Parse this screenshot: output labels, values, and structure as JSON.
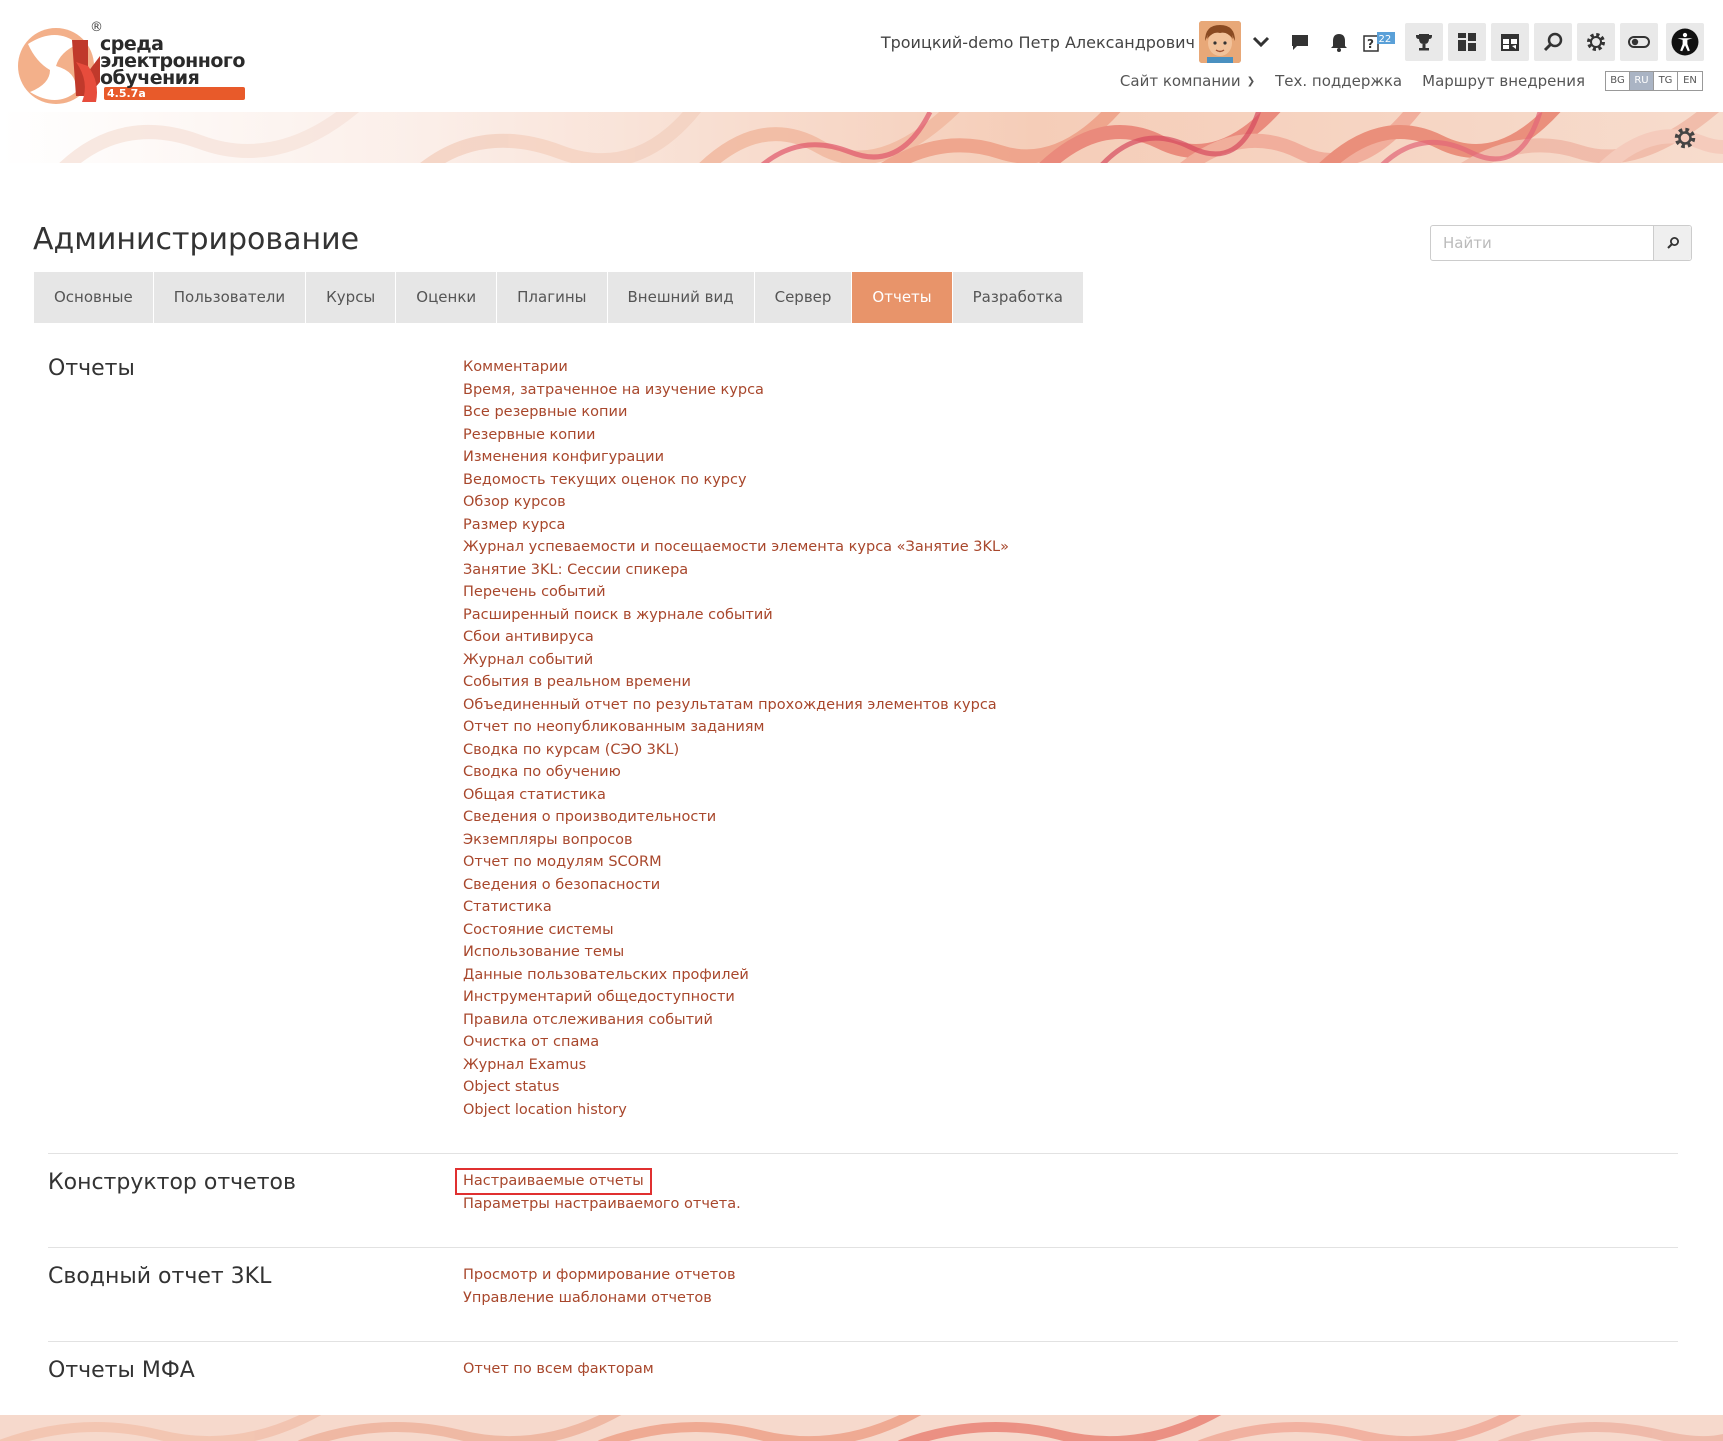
{
  "brand": {
    "line1": "среда",
    "line2": "электронного",
    "line3": "обучения",
    "version": "4.5.7a",
    "registered": "®"
  },
  "header": {
    "user_name": "Троицкий-demo Петр Александрович",
    "badge_count": "22",
    "icons": [
      "chevron-down-icon",
      "chat-icon",
      "bell-icon",
      "question-badge-icon",
      "trophy-icon",
      "dashboard-icon",
      "calendar-icon",
      "search-icon",
      "gear-icon",
      "toggle-icon",
      "accessibility-icon"
    ]
  },
  "topnav": {
    "company_site": "Сайт компании",
    "support": "Тех. поддержка",
    "route": "Маршрут внедрения",
    "languages": [
      "BG",
      "RU",
      "TG",
      "EN"
    ],
    "active_language": "RU"
  },
  "page": {
    "title": "Администрирование",
    "search_placeholder": "Найти"
  },
  "tabs": [
    {
      "label": "Основные",
      "active": false
    },
    {
      "label": "Пользователи",
      "active": false
    },
    {
      "label": "Курсы",
      "active": false
    },
    {
      "label": "Оценки",
      "active": false
    },
    {
      "label": "Плагины",
      "active": false
    },
    {
      "label": "Внешний вид",
      "active": false
    },
    {
      "label": "Сервер",
      "active": false
    },
    {
      "label": "Отчеты",
      "active": true
    },
    {
      "label": "Разработка",
      "active": false
    }
  ],
  "sections": [
    {
      "title": "Отчеты",
      "links": [
        "Комментарии",
        "Время, затраченное на изучение курса",
        "Все резервные копии",
        "Резервные копии",
        "Изменения конфигурации",
        "Ведомость текущих оценок по курсу",
        "Обзор курсов",
        "Размер курса",
        "Журнал успеваемости и посещаемости элемента курса «Занятие 3KL»",
        "Занятие 3KL: Сессии спикера",
        "Перечень событий",
        "Расширенный поиск в журнале событий",
        "Сбои антивируса",
        "Журнал событий",
        "События в реальном времени",
        "Объединенный отчет по результатам прохождения элементов курса",
        "Отчет по неопубликованным заданиям",
        "Сводка по курсам (СЭО 3KL)",
        "Сводка по обучению",
        "Общая статистика",
        "Сведения о производительности",
        "Экземпляры вопросов",
        "Отчет по модулям SCORM",
        "Сведения о безопасности",
        "Статистика",
        "Состояние системы",
        "Использование темы",
        "Данные пользовательских профилей",
        "Инструментарий общедоступности",
        "Правила отслеживания событий",
        "Очистка от спама",
        "Журнал Examus",
        "Object status",
        "Object location history"
      ]
    },
    {
      "title": "Конструктор отчетов",
      "links": [
        "Настраиваемые отчеты",
        "Параметры настраиваемого отчета."
      ]
    },
    {
      "title": "Сводный отчет 3KL",
      "links": [
        "Просмотр и формирование отчетов",
        "Управление шаблонами отчетов"
      ]
    },
    {
      "title": "Отчеты МФА",
      "links": [
        "Отчет по всем факторам"
      ]
    }
  ]
}
